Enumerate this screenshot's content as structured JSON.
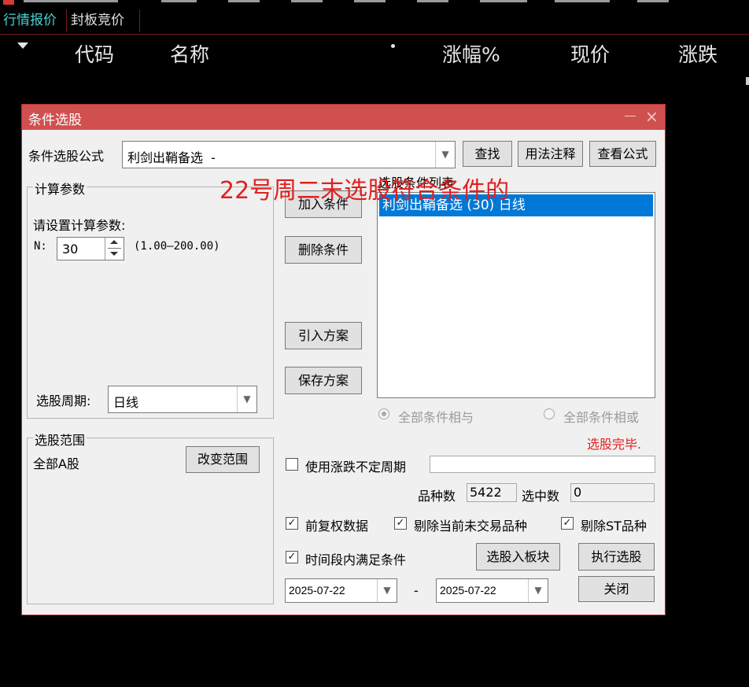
{
  "tabs": {
    "quotes": "行情报价",
    "bid": "封板竞价"
  },
  "columns": {
    "code": "代码",
    "name": "名称",
    "change_pct": "涨幅%",
    "price": "现价",
    "change": "涨跌"
  },
  "dialog": {
    "title": "条件选股",
    "formula_label": "条件选股公式",
    "formula_value": "利剑出鞘备选  -",
    "find_btn": "查找",
    "usage_btn": "用法注释",
    "view_btn": "查看公式",
    "params_group": "计算参数",
    "params_prompt": "请设置计算参数:",
    "param_name": "N:",
    "param_value": "30",
    "param_range": "(1.00—200.00)",
    "period_label": "选股周期:",
    "period_value": "日线",
    "scope_group": "选股范围",
    "scope_value": "全部A股",
    "change_scope_btn": "改变范围",
    "add_btn": "加入条件",
    "delete_btn": "删除条件",
    "import_btn": "引入方案",
    "save_btn": "保存方案",
    "conditions_label": "选股条件列表",
    "conditions": [
      "利剑出鞘备选 (30) 日线"
    ],
    "radio_and": "全部条件相与",
    "radio_or": "全部条件相或",
    "status": "选股完毕.",
    "use_variable_period": "使用涨跌不定周期",
    "variety_label": "品种数",
    "variety_count": "5422",
    "selected_label": "选中数",
    "selected_count": "0",
    "forward_adjust": "前复权数据",
    "exclude_untraded": "剔除当前未交易品种",
    "exclude_st": "剔除ST品种",
    "period_condition": "时间段内满足条件",
    "to_block_btn": "选股入板块",
    "run_btn": "执行选股",
    "date_from": "2025-07-22",
    "date_sep": "-",
    "date_to": "2025-07-22",
    "close_btn": "关闭"
  },
  "annotation": "22号周二末选股符合条件的",
  "colors": {
    "title_bar": "#d05050",
    "selection": "#0078d7",
    "status": "#e02020",
    "header_text": "#e6e6e6"
  }
}
